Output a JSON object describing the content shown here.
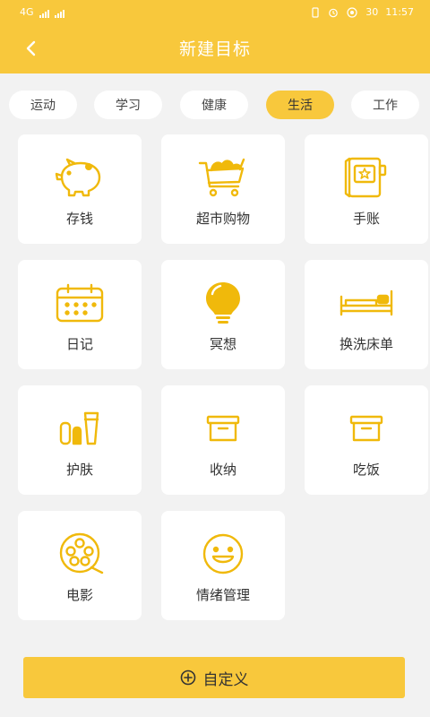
{
  "status_bar": {
    "time": "11:57",
    "battery": "30",
    "network_label": "4G"
  },
  "header": {
    "title": "新建目标"
  },
  "tabs": [
    {
      "label": "运动",
      "active": false
    },
    {
      "label": "学习",
      "active": false
    },
    {
      "label": "健康",
      "active": false
    },
    {
      "label": "生活",
      "active": true
    },
    {
      "label": "工作",
      "active": false
    }
  ],
  "goals": [
    {
      "label": "存钱",
      "icon": "piggy-bank-icon"
    },
    {
      "label": "超市购物",
      "icon": "shopping-cart-icon"
    },
    {
      "label": "手账",
      "icon": "journal-icon"
    },
    {
      "label": "日记",
      "icon": "calendar-icon"
    },
    {
      "label": "冥想",
      "icon": "light-bulb-icon"
    },
    {
      "label": "换洗床单",
      "icon": "bed-icon"
    },
    {
      "label": "护肤",
      "icon": "skincare-icon"
    },
    {
      "label": "收纳",
      "icon": "storage-box-icon"
    },
    {
      "label": "吃饭",
      "icon": "food-box-icon"
    },
    {
      "label": "电影",
      "icon": "film-reel-icon"
    },
    {
      "label": "情绪管理",
      "icon": "smiley-face-icon"
    }
  ],
  "footer": {
    "custom_label": "自定义"
  },
  "colors": {
    "accent": "#f8c83c",
    "icon": "#f0b90b",
    "background": "#f2f2f2",
    "card": "#ffffff"
  }
}
